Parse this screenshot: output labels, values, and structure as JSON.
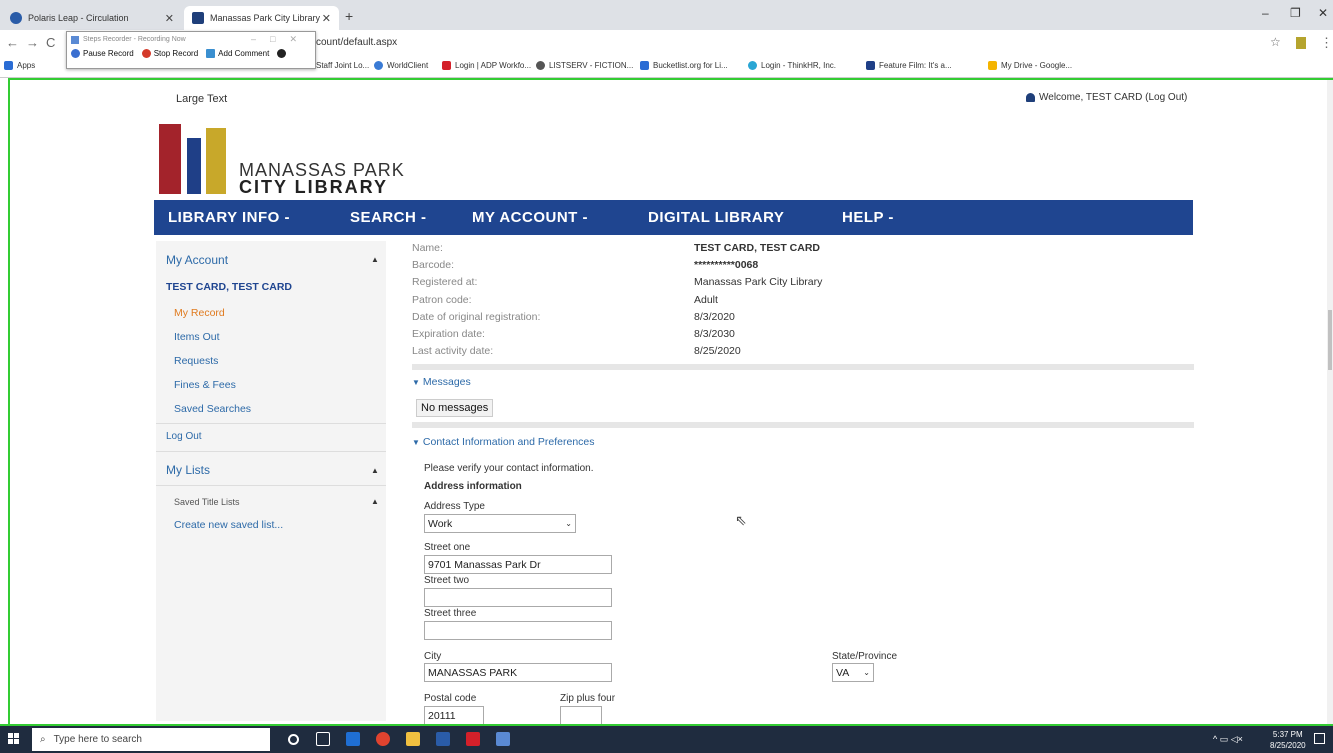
{
  "browser": {
    "tabs": [
      {
        "title": "Polaris Leap - Circulation",
        "active": false
      },
      {
        "title": "Manassas Park City Library",
        "active": true
      }
    ],
    "url": "count/default.aspx",
    "bookmarks": [
      {
        "label": "Apps"
      },
      {
        "label": "Staff Joint Lo..."
      },
      {
        "label": "WorldClient"
      },
      {
        "label": "Login | ADP Workfo..."
      },
      {
        "label": "LISTSERV - FICTION..."
      },
      {
        "label": "Bucketlist.org for Li..."
      },
      {
        "label": "Login - ThinkHR, Inc."
      },
      {
        "label": "Feature Film: It's a..."
      },
      {
        "label": "My Drive - Google..."
      }
    ]
  },
  "steps_recorder": {
    "title": "Steps Recorder - Recording Now",
    "pause": "Pause Record",
    "stop": "Stop Record",
    "comment": "Add Comment"
  },
  "header": {
    "large_text": "Large Text",
    "welcome": "Welcome, TEST CARD (Log Out)",
    "logo_line1": "MANASSAS PARK",
    "logo_line2": "CITY LIBRARY"
  },
  "nav": {
    "library_info": "LIBRARY INFO -",
    "search": "SEARCH -",
    "my_account": "MY ACCOUNT -",
    "digital_library": "DIGITAL LIBRARY",
    "help": "HELP -"
  },
  "sidebar": {
    "my_account": "My Account",
    "patron_name": "TEST CARD, TEST CARD",
    "items": [
      "My Record",
      "Items Out",
      "Requests",
      "Fines & Fees",
      "Saved Searches"
    ],
    "log_out": "Log Out",
    "my_lists": "My Lists",
    "saved_title_lists": "Saved Title Lists",
    "create_list": "Create new saved list..."
  },
  "record": {
    "rows": [
      {
        "label": "Name:",
        "value": "TEST CARD, TEST CARD"
      },
      {
        "label": "Barcode:",
        "value": "**********0068"
      },
      {
        "label": "Registered at:",
        "value": "Manassas Park City Library"
      },
      {
        "label": "Patron code:",
        "value": "Adult"
      },
      {
        "label": "Date of original registration:",
        "value": "8/3/2020"
      },
      {
        "label": "Expiration date:",
        "value": "8/3/2030"
      },
      {
        "label": "Last activity date:",
        "value": "8/25/2020"
      }
    ]
  },
  "messages": {
    "heading": "Messages",
    "none": "No messages"
  },
  "contact": {
    "heading": "Contact Information and Preferences",
    "verify": "Please verify your contact information.",
    "address_info": "Address information",
    "address_type_label": "Address Type",
    "address_type_value": "Work",
    "street_one_label": "Street one",
    "street_one_value": "9701 Manassas Park Dr",
    "street_two_label": "Street two",
    "street_two_value": "",
    "street_three_label": "Street three",
    "street_three_value": "",
    "city_label": "City",
    "city_value": "MANASSAS PARK",
    "state_label": "State/Province",
    "state_value": "VA",
    "postal_label": "Postal code",
    "postal_value": "20111",
    "zip4_label": "Zip plus four",
    "zip4_value": ""
  },
  "taskbar": {
    "search_placeholder": "Type here to search",
    "time": "5:37 PM",
    "date": "8/25/2020"
  },
  "colors": {
    "nav_blue": "#1f4590",
    "link_blue": "#2d6aa8",
    "current_orange": "#e07b20",
    "recording_border": "#33cc33"
  }
}
